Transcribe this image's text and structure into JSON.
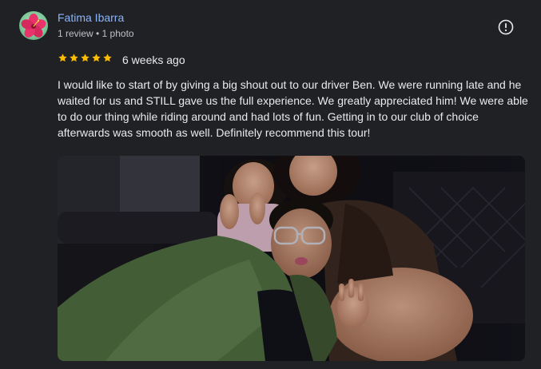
{
  "reviewer": {
    "name": "Fatima Ibarra",
    "meta": "1 review • 1 photo",
    "avatar_icon": "hibiscus-flower-icon"
  },
  "review": {
    "rating": 5,
    "rating_max": 5,
    "date": "6 weeks ago",
    "text": "I would like to start of by giving a big shout out to our driver Ben. We were running late and he waited for us and STILL gave us the full experience. We greatly appreciated him! We were able to do our thing while riding around and had lots of fun. Getting in to our club of choice afterwards was smooth as well. Definitely recommend this tour!"
  },
  "icons": {
    "more": "info-alert-icon",
    "star": "star-icon"
  },
  "colors": {
    "background": "#202124",
    "name_link": "#8ab4f8",
    "star": "#fbbc04",
    "text": "#e8eaed",
    "meta": "#bdc1c6"
  }
}
